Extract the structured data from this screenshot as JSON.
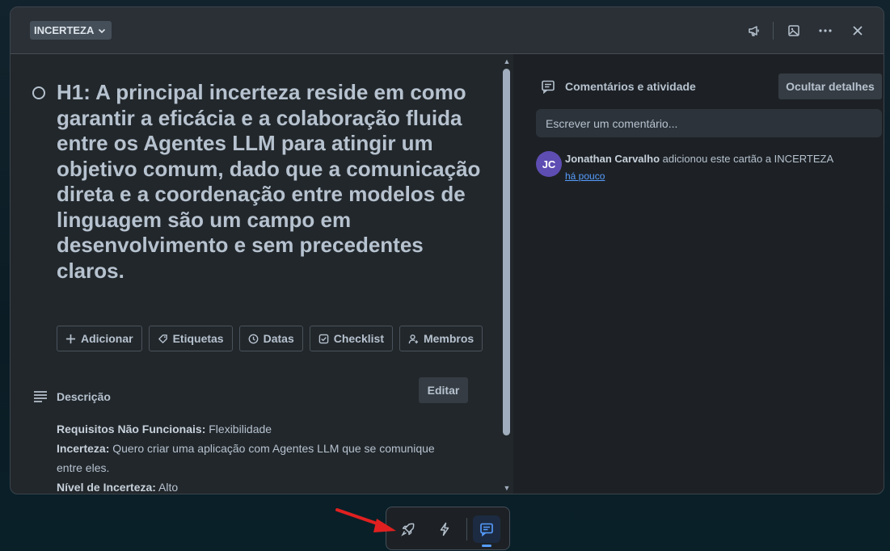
{
  "header": {
    "list_name": "INCERTEZA",
    "icons": [
      "megaphone-icon",
      "image-icon",
      "more-icon",
      "close-icon"
    ]
  },
  "card": {
    "title": "H1: A principal incerteza reside em como garantir a eficácia e a colaboração fluida entre os Agentes LLM para atingir um objetivo comum, dado que a comunicação direta e a coordenação entre modelos de linguagem são um campo em desenvolvimento e sem precedentes claros.",
    "actions": [
      "Adicionar",
      "Etiquetas",
      "Datas",
      "Checklist",
      "Membros"
    ],
    "description": {
      "heading": "Descrição",
      "edit_label": "Editar",
      "lines": [
        {
          "label": "Requisitos Não Funcionais:",
          "text": " Flexibilidade"
        },
        {
          "label": "Incerteza:",
          "text": " Quero criar uma aplicação com Agentes LLM que se comunique entre eles."
        },
        {
          "label": "Nível de Incerteza:",
          "text": " Alto"
        }
      ]
    }
  },
  "comments": {
    "heading": "Comentários e atividade",
    "hide_label": "Ocultar detalhes",
    "input_placeholder": "Escrever um comentário...",
    "activity": {
      "avatar_initials": "JC",
      "user": "Jonathan Carvalho",
      "action": " adicionou este cartão a INCERTEZA",
      "time": "há pouco"
    }
  },
  "dock": {
    "buttons": [
      "rocket-icon",
      "bolt-icon",
      "comment-icon"
    ],
    "active": "comment-icon"
  },
  "colors": {
    "accent": "#579dff",
    "avatar": "#5e4db2",
    "annotation_arrow": "#e02020"
  }
}
